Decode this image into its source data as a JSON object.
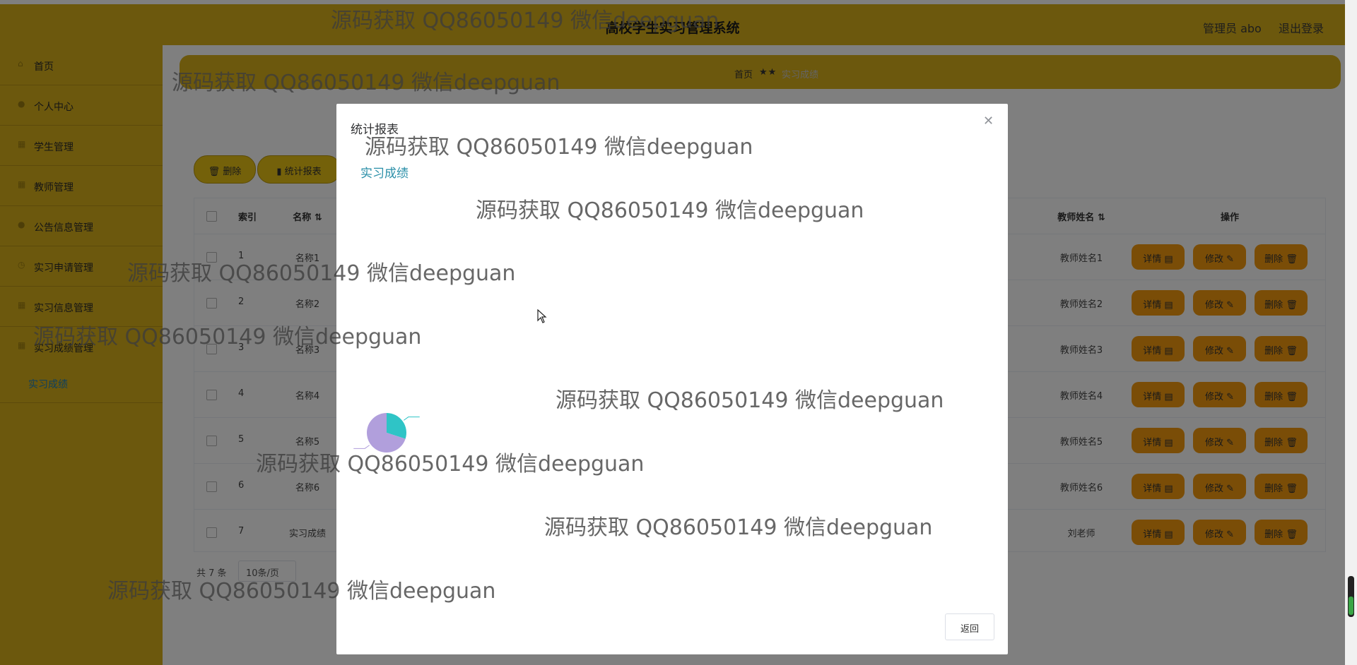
{
  "header": {
    "title": "高校学生实习管理系统",
    "user": "管理员 abo",
    "logout": "退出登录"
  },
  "sidebar": {
    "items": [
      {
        "label": "首页",
        "icon": "home-icon"
      },
      {
        "label": "个人中心",
        "icon": "user-icon"
      },
      {
        "label": "学生管理",
        "icon": "grid-icon"
      },
      {
        "label": "教师管理",
        "icon": "grid-icon"
      },
      {
        "label": "公告信息管理",
        "icon": "user-icon"
      },
      {
        "label": "实习申请管理",
        "icon": "clock-icon"
      },
      {
        "label": "实习信息管理",
        "icon": "grid-icon"
      },
      {
        "label": "实习成绩管理",
        "icon": "grid-icon"
      }
    ],
    "submenu": {
      "label": "实习成绩"
    }
  },
  "breadcrumb": {
    "home": "首页",
    "separator": "★★",
    "current": "实习成绩"
  },
  "toolbar": {
    "delete_label": "删除",
    "report_label": "统计报表"
  },
  "table": {
    "headers": {
      "select": "",
      "index": "索引",
      "name": "名称",
      "teacher": "教师姓名",
      "actions": "操作"
    },
    "rows": [
      {
        "index": "1",
        "name": "名称1",
        "teacher": "教师姓名1"
      },
      {
        "index": "2",
        "name": "名称2",
        "teacher": "教师姓名2"
      },
      {
        "index": "3",
        "name": "名称3",
        "teacher": "教师姓名3"
      },
      {
        "index": "4",
        "name": "名称4",
        "teacher": "教师姓名4"
      },
      {
        "index": "5",
        "name": "名称5",
        "teacher": "教师姓名5"
      },
      {
        "index": "6",
        "name": "名称6",
        "teacher": "教师姓名6"
      },
      {
        "index": "7",
        "name": "实习成绩",
        "teacher": "刘老师"
      }
    ],
    "actions": {
      "detail": "详情",
      "edit": "修改",
      "delete": "删除"
    }
  },
  "pagination": {
    "total": "共 7 条",
    "page_size": "10条/页"
  },
  "dialog": {
    "title": "统计报表",
    "chart_title": "实习成绩",
    "back_label": "返回",
    "close_icon": "close-icon"
  },
  "chart_data": {
    "type": "pie",
    "title": "实习成绩",
    "slices": [
      {
        "value": 0.3,
        "color": "#2fc4c6"
      },
      {
        "value": 0.7,
        "color": "#b19fdc"
      }
    ]
  },
  "watermark": {
    "text": "源码获取 QQ86050149 微信deepguan"
  },
  "colors": {
    "header": "#d8b11b",
    "accent": "#f59a0f",
    "link": "#2a8fa8"
  }
}
